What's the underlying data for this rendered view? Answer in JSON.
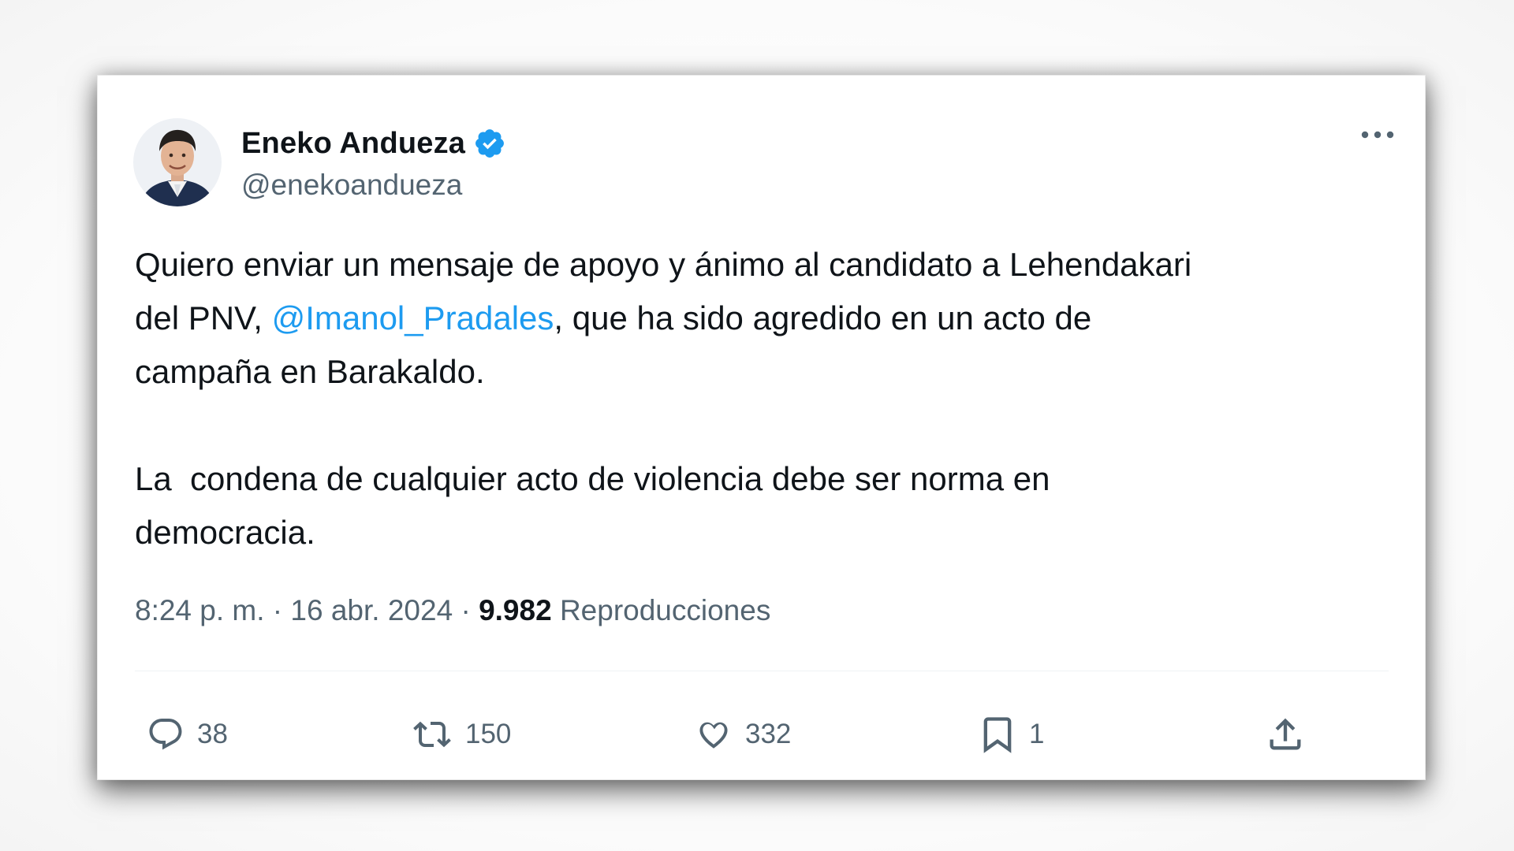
{
  "tweet": {
    "author": {
      "name": "Eneko Andueza",
      "handle": "@enekoandueza",
      "verified": true,
      "verified_color": "#1d9bf0"
    },
    "text": {
      "line1": "Quiero enviar un mensaje de apoyo y ánimo al candidato a Lehendakari",
      "line2_before": "del PNV, ",
      "mention": "@Imanol_Pradales",
      "line2_after": ", que ha sido agredido en un acto de",
      "line3": "campaña en Barakaldo.",
      "para2_line1": "La  condena de cualquier acto de violencia debe ser norma en",
      "para2_line2": "democracia."
    },
    "meta": {
      "time": "8:24 p. m.",
      "separator": " · ",
      "date": "16 abr. 2024",
      "views_count": "9.982",
      "views_label": "Reproducciones"
    },
    "actions": {
      "replies": "38",
      "retweets": "150",
      "likes": "332",
      "bookmarks": "1"
    },
    "icons": {
      "more": "more-horizontal-icon",
      "reply": "reply-icon",
      "retweet": "retweet-icon",
      "like": "heart-icon",
      "bookmark": "bookmark-icon",
      "share": "share-icon"
    },
    "colors": {
      "text": "#0f1419",
      "secondary": "#536471",
      "link": "#1d9bf0"
    }
  }
}
